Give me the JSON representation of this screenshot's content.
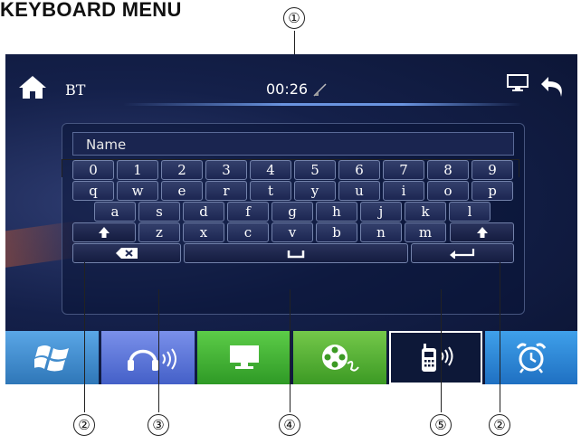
{
  "heading": "KEYBOARD MENU",
  "callouts": [
    "①",
    "②",
    "③",
    "④",
    "⑤",
    "②"
  ],
  "status": {
    "bt": "BT",
    "time": "00:26"
  },
  "field": {
    "label": "Name"
  },
  "keyboard": {
    "row1": [
      "0",
      "1",
      "2",
      "3",
      "4",
      "5",
      "6",
      "7",
      "8",
      "9"
    ],
    "row2": [
      "q",
      "w",
      "e",
      "r",
      "t",
      "y",
      "u",
      "i",
      "o",
      "p"
    ],
    "row3": [
      "a",
      "s",
      "d",
      "f",
      "g",
      "h",
      "j",
      "k",
      "l"
    ],
    "row4": [
      "z",
      "x",
      "c",
      "v",
      "b",
      "n",
      "m"
    ]
  },
  "icons": {
    "home": "home-icon",
    "signal": "signal-icon",
    "monitor": "monitor-icon",
    "back": "back-icon",
    "shift": "shift-icon",
    "backspace": "backspace-icon",
    "space": "space-icon",
    "enter": "enter-icon",
    "windows": "windows-icon",
    "music": "headphones-icon",
    "display": "monitor-icon",
    "video": "film-reel-icon",
    "phone": "phone-icon",
    "alarm": "alarm-clock-icon"
  },
  "taskbar_colors": [
    "#3d86c6",
    "#5a78d6",
    "#3fae33",
    "#5ab034",
    "#ffffff",
    "#2f8ad6"
  ]
}
